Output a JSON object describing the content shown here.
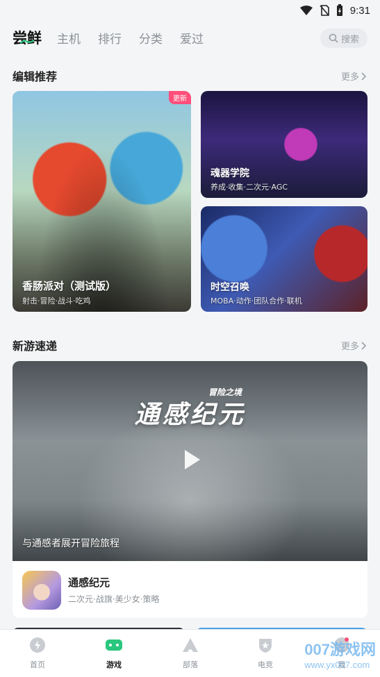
{
  "status": {
    "time": "9:31"
  },
  "tabs": [
    {
      "label": "尝鲜",
      "active": true
    },
    {
      "label": "主机"
    },
    {
      "label": "排行"
    },
    {
      "label": "分类"
    },
    {
      "label": "爱过"
    }
  ],
  "search": {
    "placeholder": "搜索"
  },
  "editor": {
    "title": "编辑推荐",
    "more": "更多",
    "cards": [
      {
        "title": "香肠派对（测试版）",
        "tags": "射击·冒险·战斗·吃鸡",
        "badge": "更新"
      },
      {
        "title": "魂器学院",
        "tags": "养成·收集·二次元·AGC"
      },
      {
        "title": "时空召唤",
        "tags": "MOBA·动作·团队合作·联机"
      }
    ]
  },
  "newgames": {
    "title": "新游速递",
    "more": "更多",
    "feature": {
      "logo_main": "通感纪元",
      "logo_sub": "冒险之境",
      "caption": "与通感者展开冒险旅程",
      "app_name": "通感纪元",
      "app_tags": "二次元·战旗·美少女·策略"
    }
  },
  "bottom_nav": [
    {
      "label": "首页",
      "icon": "home-icon"
    },
    {
      "label": "游戏",
      "icon": "gamepad-icon",
      "active": true
    },
    {
      "label": "部落",
      "icon": "tribe-icon"
    },
    {
      "label": "电竞",
      "icon": "esports-icon"
    },
    {
      "label": "我",
      "icon": "profile-icon"
    }
  ],
  "watermark": {
    "main": "007游戏网",
    "sub": "www.yx007.com"
  },
  "colors": {
    "accent": "#2ac77f",
    "badge": "#ff4f7a",
    "more": "#9aa0a6"
  }
}
